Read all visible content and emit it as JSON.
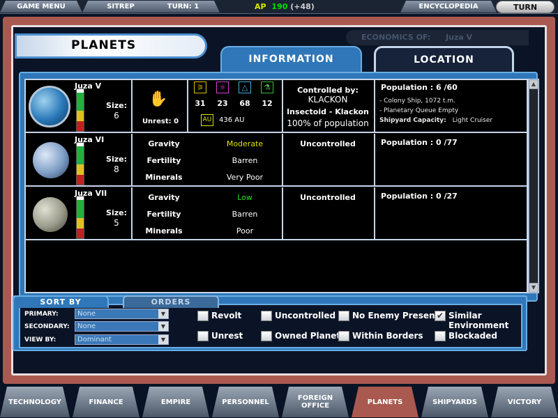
{
  "topbar": {
    "game_menu": "GAME MENU",
    "sitrep": "SITREP",
    "turn_label": "TURN: 1",
    "resource_icon": "AP",
    "resource_value": "190",
    "resource_delta": "(+48)",
    "encyclopedia": "ENCYCLOPEDIA",
    "turn_button": "TURN"
  },
  "header": {
    "title": "PLANETS",
    "economics_label": "ECONOMICS OF:",
    "economics_value": "Juza V",
    "tab_information": "INFORMATION",
    "tab_location": "LOCATION"
  },
  "planets": [
    {
      "name": "Juza V",
      "size_label": "Size:",
      "size": "6",
      "color": "#3a8cc8",
      "morale_fill": {
        "white": 0.08,
        "green": 0.42,
        "yellow": 0.25,
        "red": 0.25
      },
      "unrest_label": "Unrest: 0",
      "unrest_icon": "thumbs-up-icon",
      "outputs": [
        {
          "icon": "food-icon",
          "value": "31",
          "color": "#e0c000"
        },
        {
          "icon": "industry-icon",
          "value": "23",
          "color": "#d040d0"
        },
        {
          "icon": "research-icon",
          "value": "68",
          "color": "#40b0e0"
        },
        {
          "icon": "science-icon",
          "value": "12",
          "color": "#40c040"
        }
      ],
      "distance_icon": "AU",
      "distance": "436 AU",
      "control": {
        "label": "Controlled by:",
        "owner": "KLACKON",
        "race": "Insectoid - Klackon",
        "percent": "100% of population"
      },
      "population": "Population : 6 /60",
      "notes": [
        "- Colony Ship, 1072 t.m.",
        "- Planetary Queue Empty"
      ],
      "shipyard_label": "Shipyard Capacity:",
      "shipyard_value": "Light Cruiser"
    },
    {
      "name": "Juza VI",
      "size_label": "Size:",
      "size": "8",
      "color": "#7a9cc0",
      "morale_fill": {
        "white": 0.08,
        "green": 0.42,
        "yellow": 0.25,
        "red": 0.25
      },
      "gravity_label": "Gravity",
      "gravity": "Moderate",
      "gravity_color": "#e0e000",
      "fertility_label": "Fertility",
      "fertility": "Barren",
      "minerals_label": "Minerals",
      "minerals": "Very Poor",
      "control": {
        "label": "Uncontrolled"
      },
      "population": "Population : 0 /77"
    },
    {
      "name": "Juza VII",
      "size_label": "Size:",
      "size": "5",
      "color": "#9a9a8a",
      "morale_fill": {
        "white": 0.08,
        "green": 0.42,
        "yellow": 0.25,
        "red": 0.25
      },
      "gravity_label": "Gravity",
      "gravity": "Low",
      "gravity_color": "#20e020",
      "fertility_label": "Fertility",
      "fertility": "Barren",
      "minerals_label": "Minerals",
      "minerals": "Poor",
      "control": {
        "label": "Uncontrolled"
      },
      "population": "Population : 0 /27"
    }
  ],
  "sort": {
    "tab_sortby": "SORT BY",
    "tab_orders": "ORDERS",
    "primary_label": "PRIMARY:",
    "primary_value": "None",
    "secondary_label": "SECONDARY:",
    "secondary_value": "None",
    "viewby_label": "VIEW BY:",
    "viewby_value": "Dominant",
    "filters": [
      {
        "label": "Revolt",
        "checked": false
      },
      {
        "label": "Uncontrolled",
        "checked": false
      },
      {
        "label": "No Enemy Presence",
        "checked": false
      },
      {
        "label": "Similar Environment",
        "checked": true
      },
      {
        "label": "Unrest",
        "checked": false
      },
      {
        "label": "Owned Planets",
        "checked": false
      },
      {
        "label": "Within Borders",
        "checked": false
      },
      {
        "label": "Blockaded",
        "checked": false
      }
    ]
  },
  "bottom_nav": [
    {
      "label": "TECHNOLOGY"
    },
    {
      "label": "FINANCE"
    },
    {
      "label": "EMPIRE"
    },
    {
      "label": "PERSONNEL"
    },
    {
      "label": "FOREIGN OFFICE"
    },
    {
      "label": "PLANETS",
      "active": true
    },
    {
      "label": "SHIPYARDS"
    },
    {
      "label": "VICTORY"
    }
  ],
  "colors": {
    "frame": "#a9594f",
    "accent": "#2f77b8",
    "border": "#c6d6ea"
  }
}
